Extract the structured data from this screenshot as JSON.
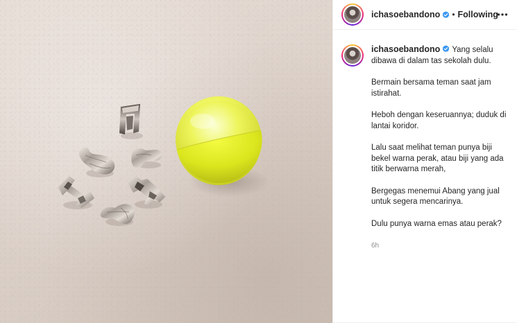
{
  "post": {
    "author": {
      "username": "ichasoebandono",
      "verified": true,
      "avatar_icon": "profile-avatar"
    },
    "header": {
      "separator": "•",
      "follow_label": "Following",
      "more_icon": "more-horizontal-icon"
    },
    "caption": {
      "first_line": "Yang selalu dibawa di dalam tas sekolah dulu.",
      "paragraphs": [
        "Bermain bersama teman saat jam istirahat.",
        "Heboh dengan keseruannya; duduk di lantai koridor.",
        "Lalu saat melihat teman punya biji bekel warna perak, atau biji yang ada titik berwarna merah,",
        "Bergegas menemui Abang yang jual untuk segera mencarinya.",
        "Dulu punya warna emas atau perak?"
      ],
      "timestamp": "6h"
    },
    "photo": {
      "subject": "yellow bekel ball with silver bekel jacks",
      "colors": {
        "background": "#dcd1c9",
        "ball": "#e6ef3a",
        "jacks": "#9c9690"
      }
    },
    "colors": {
      "text": "#262626",
      "muted": "#8e8e8e",
      "verified": "#3897f0",
      "border": "#efefef"
    }
  }
}
